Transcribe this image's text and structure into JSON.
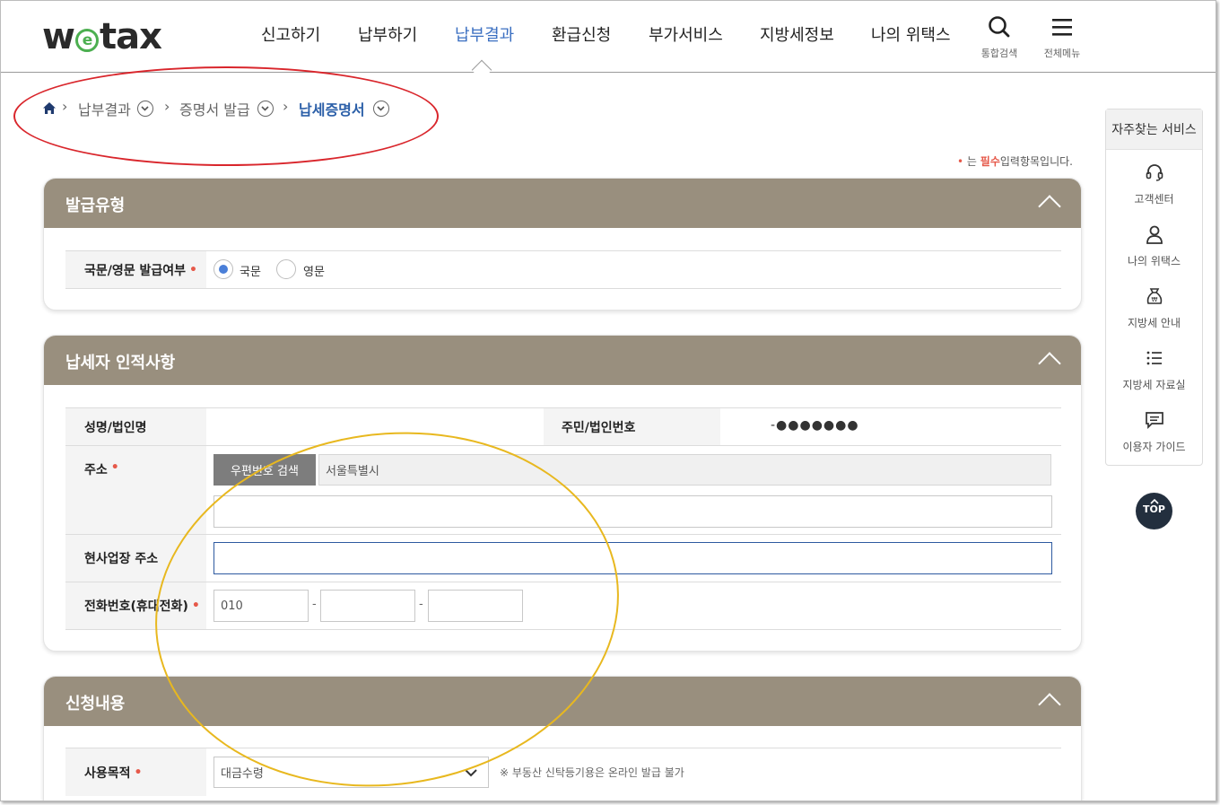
{
  "logo": {
    "pre": "w",
    "e": "e",
    "post": "tax"
  },
  "nav": {
    "items": [
      {
        "label": "신고하기"
      },
      {
        "label": "납부하기"
      },
      {
        "label": "납부결과",
        "active": true
      },
      {
        "label": "환급신청"
      },
      {
        "label": "부가서비스"
      },
      {
        "label": "지방세정보"
      },
      {
        "label": "나의 위택스"
      }
    ],
    "search_label": "통합검색",
    "menu_label": "전체메뉴"
  },
  "breadcrumb": {
    "items": [
      "납부결과",
      "증명서 발급",
      "납세증명서"
    ]
  },
  "required_note": {
    "dot": "•",
    "pre": "는",
    "word": "필수",
    "post": "입력항목입니다."
  },
  "sections": {
    "issue_type": {
      "title": "발급유형",
      "field_label": "국문/영문 발급여부",
      "options": [
        {
          "label": "국문",
          "checked": true
        },
        {
          "label": "영문",
          "checked": false
        }
      ]
    },
    "taxpayer": {
      "title": "납세자 인적사항",
      "name_label": "성명/법인명",
      "name_value": "",
      "id_label": "주민/법인번호",
      "id_value": "-●●●●●●●",
      "address_label": "주소",
      "postal_button": "우편번호 검색",
      "address_value": "서울특별시",
      "address_detail": "",
      "business_label": "현사업장 주소",
      "business_value": "",
      "phone_label": "전화번호(휴대전화)",
      "phone": [
        "010",
        "",
        ""
      ],
      "phone_sep": "-"
    },
    "application": {
      "title": "신청내용",
      "purpose_label": "사용목적",
      "purpose_value": "대금수령",
      "purpose_note": "※ 부동산 신탁등기용은 온라인 발급 불가"
    }
  },
  "required_mark": "•",
  "quick_menu": {
    "title": "자주찾는 서비스",
    "items": [
      {
        "label": "고객센터",
        "icon": "headset-icon"
      },
      {
        "label": "나의 위택스",
        "icon": "person-icon"
      },
      {
        "label": "지방세 안내",
        "icon": "money-bag-icon"
      },
      {
        "label": "지방세 자료실",
        "icon": "list-icon"
      },
      {
        "label": "이용자 가이드",
        "icon": "chat-icon"
      }
    ]
  },
  "top_button": "TOP",
  "colors": {
    "section_header": "#998f7e",
    "accent": "#3b6fc1",
    "required": "#e6594a",
    "annotation_red": "#d9262c",
    "annotation_yellow": "#e8b81f"
  }
}
